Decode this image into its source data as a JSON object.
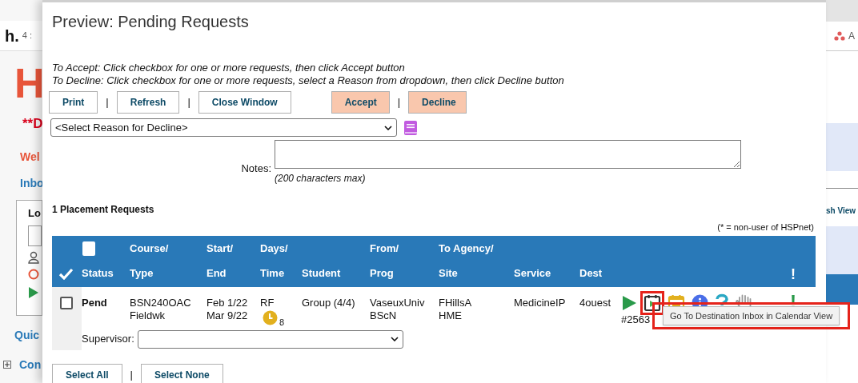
{
  "background": {
    "left": {
      "logo": "h.",
      "tab_text": "4 :",
      "heading": "H",
      "alert": "**D",
      "welcome": "Wel",
      "inbox": "Inbo",
      "box_label": "Lo",
      "quick": "Quic",
      "section": "Con"
    },
    "right": {
      "menu_text": "A",
      "view_button": "sh View"
    }
  },
  "modal": {
    "title": "Preview: Pending Requests",
    "instructions": [
      "To Accept: Click checkbox for one or more requests, then click Accept button",
      "To Decline: Click checkbox for one or more requests, select a Reason from dropdown, then click Decline button"
    ],
    "toolbar": [
      {
        "kind": "button",
        "label": "Print"
      },
      {
        "kind": "separator",
        "label": "|"
      },
      {
        "kind": "button",
        "label": "Refresh"
      },
      {
        "kind": "separator",
        "label": "|"
      },
      {
        "kind": "button",
        "label": "Close Window"
      },
      {
        "kind": "gap"
      },
      {
        "kind": "action",
        "label": "Accept"
      },
      {
        "kind": "separator",
        "label": "|"
      },
      {
        "kind": "action",
        "label": "Decline"
      }
    ],
    "reason_select": {
      "value": "<Select Reason for Decline>"
    },
    "notes": {
      "label": "Notes:",
      "hint": "(200 characters max)"
    },
    "section_title": "1 Placement Requests",
    "legend": "(* = non-user of HSPnet)",
    "table": {
      "columns": [
        {
          "kind": "check"
        },
        {
          "kind": "icon_text",
          "line2": "Status"
        },
        {
          "kind": "text",
          "line1": "Course/",
          "line2": "Type"
        },
        {
          "kind": "text",
          "line1": "Start/",
          "line2": "End"
        },
        {
          "kind": "text",
          "line1": "Days/",
          "line2": "Time"
        },
        {
          "kind": "text",
          "line2": "Student"
        },
        {
          "kind": "text",
          "line1": "From/",
          "line2": "Prog"
        },
        {
          "kind": "text",
          "line1": "To Agency/",
          "line2": "Site"
        },
        {
          "kind": "text",
          "line2": "Service"
        },
        {
          "kind": "text",
          "line2": "Dest"
        },
        {
          "kind": "text"
        },
        {
          "kind": "text",
          "line2": "!"
        }
      ],
      "rows": [
        {
          "checked": false,
          "status": "Pend",
          "course": [
            "BSN240OAC",
            "Fieldwk"
          ],
          "dates": [
            "Feb 1/22",
            "Mar 9/22"
          ],
          "days": "RF",
          "hours": "8",
          "student": "Group (4/4)",
          "from": [
            "VaseuxUniv",
            "BScN"
          ],
          "to": [
            "FHillsA",
            "HME"
          ],
          "service": "MedicineIP",
          "dest": "4ouest",
          "reference": "#2563",
          "alert": "!",
          "supervisor": {
            "label": "Supervisor:"
          }
        }
      ]
    },
    "bottom_buttons": [
      {
        "kind": "button",
        "label": "Select All"
      },
      {
        "kind": "separator",
        "label": "|"
      },
      {
        "kind": "button",
        "label": "Select None"
      }
    ],
    "tooltip": {
      "text": "Go To Destination Inbox in Calendar View"
    }
  }
}
